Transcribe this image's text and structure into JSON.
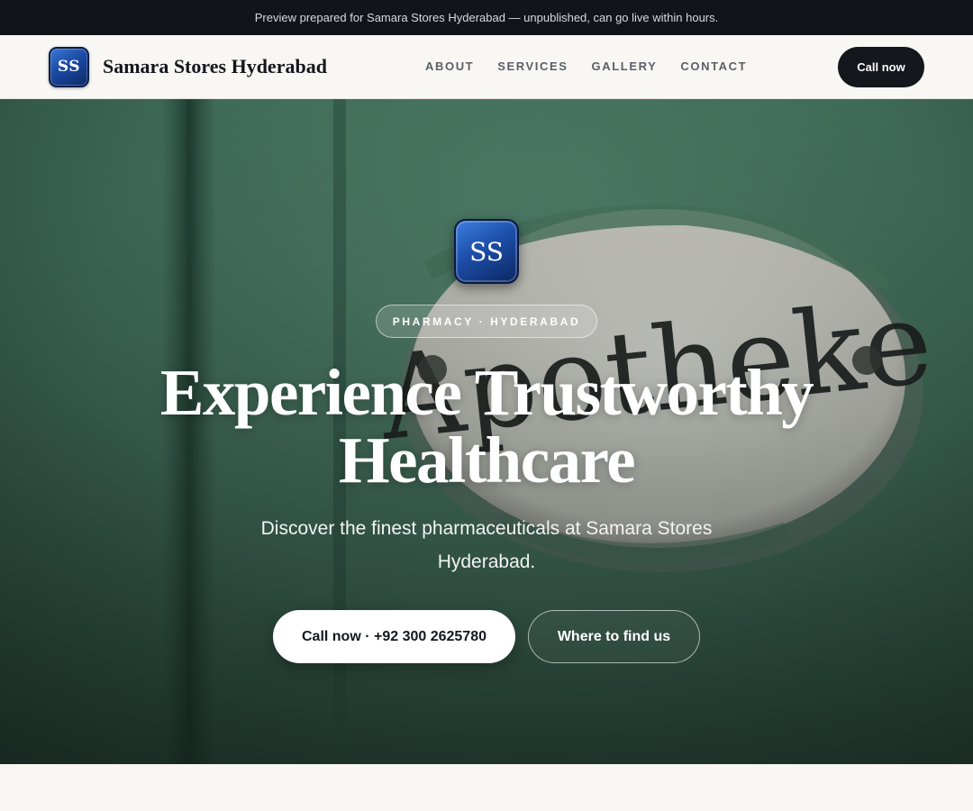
{
  "announcement": "Preview prepared for Samara Stores Hyderabad — unpublished, can go live within hours.",
  "brand": {
    "logo_initials": "SS",
    "name": "Samara Stores Hyderabad"
  },
  "nav": {
    "links": [
      "ABOUT",
      "SERVICES",
      "GALLERY",
      "CONTACT"
    ],
    "cta": "Call now"
  },
  "hero": {
    "badge_initials": "SS",
    "eyebrow": "PHARMACY · HYDERABAD",
    "headline_line1": "Experience Trustworthy",
    "headline_line2": "Healthcare",
    "subtext": "Discover the finest pharmaceuticals at Samara Stores Hyderabad.",
    "primary_button": "Call now · +92 300 2625780",
    "secondary_button": "Where to find us",
    "background_image": {
      "subject": "green painted door with oval enamel Apotheke sign",
      "sign_text": "Apotheke"
    }
  },
  "colors": {
    "topbar": "#111418",
    "nav_bg": "#f8f7f4",
    "cta_dark": "#14171c",
    "hero_green": "#3d6b57",
    "logo_blue": "#1d4ea9"
  }
}
